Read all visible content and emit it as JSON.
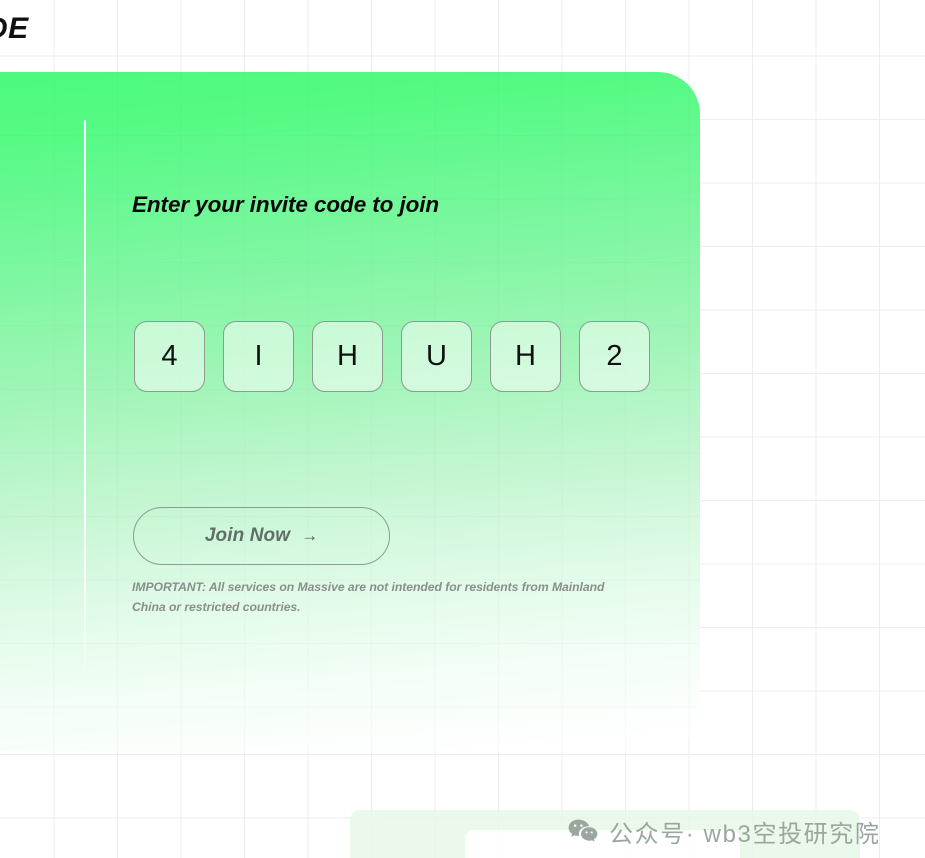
{
  "header": {
    "title_fragment": "DE"
  },
  "panel": {
    "heading": "Enter your invite code to join",
    "background_top_color": "#4df97e",
    "background_mid_color": "#9df5b5",
    "background_bottom_color": "#ffffff"
  },
  "invite_code": {
    "digits": [
      "4",
      "I",
      "H",
      "U",
      "H",
      "2"
    ],
    "box_count": 6
  },
  "join": {
    "label": "Join Now",
    "arrow": "→"
  },
  "disclaimer": {
    "text": "IMPORTANT: All services on Massive are not intended for residents from Mainland China or restricted countries."
  },
  "watermark": {
    "text": "公众号· wb3空投研究院",
    "icon": "wechat-icon",
    "color": "#9aa79e"
  }
}
